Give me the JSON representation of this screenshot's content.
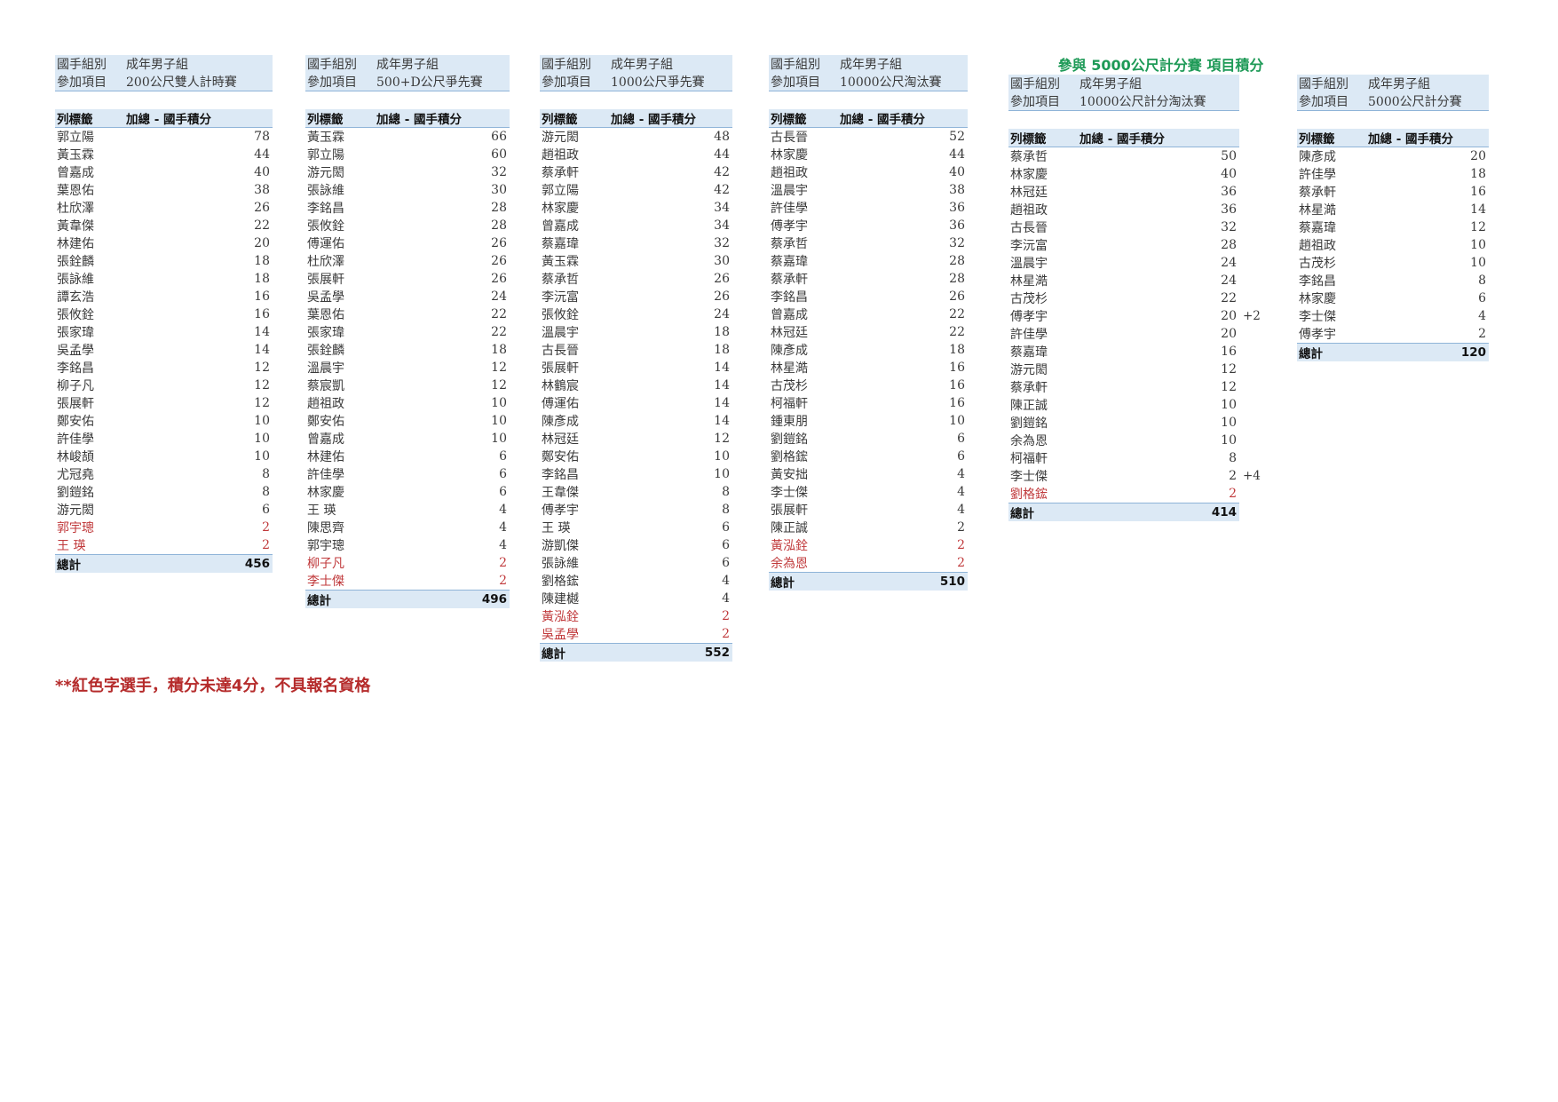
{
  "section_title": "參與 5000公尺計分賽 項目積分",
  "footnote": "**紅色字選手，積分未達4分，不具報名資格",
  "colors": {
    "header_bg": "#dce9f5",
    "header_line": "#8fb4d8",
    "red": "#c0393b",
    "green": "#1e9a57"
  },
  "tables": [
    {
      "group_label": "國手組別",
      "group_value": "成年男子組",
      "event_label": "參加項目",
      "event_value": "200公尺雙人計時賽",
      "col_label": "列標籤",
      "col_value": "加總 - 國手積分",
      "total_label": "總計",
      "total": "456",
      "rows": [
        {
          "name": "郭立陽",
          "pts": "78"
        },
        {
          "name": "黃玉霖",
          "pts": "44"
        },
        {
          "name": "曾嘉成",
          "pts": "40"
        },
        {
          "name": "葉恩佑",
          "pts": "38"
        },
        {
          "name": "杜欣澤",
          "pts": "26"
        },
        {
          "name": "黃韋傑",
          "pts": "22"
        },
        {
          "name": "林建佑",
          "pts": "20"
        },
        {
          "name": "張銓麟",
          "pts": "18"
        },
        {
          "name": "張詠維",
          "pts": "18"
        },
        {
          "name": "譚玄浩",
          "pts": "16"
        },
        {
          "name": "張攸銓",
          "pts": "16"
        },
        {
          "name": "張家瑋",
          "pts": "14"
        },
        {
          "name": "吳孟學",
          "pts": "14"
        },
        {
          "name": "李銘昌",
          "pts": "12"
        },
        {
          "name": "柳子凡",
          "pts": "12"
        },
        {
          "name": "張展軒",
          "pts": "12"
        },
        {
          "name": "鄭安佑",
          "pts": "10"
        },
        {
          "name": "許佳學",
          "pts": "10"
        },
        {
          "name": "林峻頡",
          "pts": "10"
        },
        {
          "name": "尤冠堯",
          "pts": "8"
        },
        {
          "name": "劉鎧銘",
          "pts": "8"
        },
        {
          "name": "游元閎",
          "pts": "6"
        },
        {
          "name": "郭宇璁",
          "pts": "2",
          "red": true
        },
        {
          "name": "王 瑛",
          "pts": "2",
          "red": true
        }
      ]
    },
    {
      "group_label": "國手組別",
      "group_value": "成年男子組",
      "event_label": "參加項目",
      "event_value": "500+D公尺爭先賽",
      "col_label": "列標籤",
      "col_value": "加總 - 國手積分",
      "total_label": "總計",
      "total": "496",
      "rows": [
        {
          "name": "黃玉霖",
          "pts": "66"
        },
        {
          "name": "郭立陽",
          "pts": "60"
        },
        {
          "name": "游元閎",
          "pts": "32"
        },
        {
          "name": "張詠維",
          "pts": "30"
        },
        {
          "name": "李銘昌",
          "pts": "28"
        },
        {
          "name": "張攸銓",
          "pts": "28"
        },
        {
          "name": "傅運佑",
          "pts": "26"
        },
        {
          "name": "杜欣澤",
          "pts": "26"
        },
        {
          "name": "張展軒",
          "pts": "26"
        },
        {
          "name": "吳孟學",
          "pts": "24"
        },
        {
          "name": "葉恩佑",
          "pts": "22"
        },
        {
          "name": "張家瑋",
          "pts": "22"
        },
        {
          "name": "張銓麟",
          "pts": "18"
        },
        {
          "name": "溫晨宇",
          "pts": "12"
        },
        {
          "name": "蔡宸凱",
          "pts": "12"
        },
        {
          "name": "趙祖政",
          "pts": "10"
        },
        {
          "name": "鄭安佑",
          "pts": "10"
        },
        {
          "name": "曾嘉成",
          "pts": "10"
        },
        {
          "name": "林建佑",
          "pts": "6"
        },
        {
          "name": "許佳學",
          "pts": "6"
        },
        {
          "name": "林家慶",
          "pts": "6"
        },
        {
          "name": "王 瑛",
          "pts": "4"
        },
        {
          "name": "陳思齊",
          "pts": "4"
        },
        {
          "name": "郭宇璁",
          "pts": "4"
        },
        {
          "name": "柳子凡",
          "pts": "2",
          "red": true
        },
        {
          "name": "李士傑",
          "pts": "2",
          "red": true
        }
      ]
    },
    {
      "group_label": "國手組別",
      "group_value": "成年男子組",
      "event_label": "參加項目",
      "event_value": "1000公尺爭先賽",
      "col_label": "列標籤",
      "col_value": "加總 - 國手積分",
      "total_label": "總計",
      "total": "552",
      "rows": [
        {
          "name": "游元閎",
          "pts": "48"
        },
        {
          "name": "趙祖政",
          "pts": "44"
        },
        {
          "name": "蔡承軒",
          "pts": "42"
        },
        {
          "name": "郭立陽",
          "pts": "42"
        },
        {
          "name": "林家慶",
          "pts": "34"
        },
        {
          "name": "曾嘉成",
          "pts": "34"
        },
        {
          "name": "蔡嘉瑋",
          "pts": "32"
        },
        {
          "name": "黃玉霖",
          "pts": "30"
        },
        {
          "name": "蔡承哲",
          "pts": "26"
        },
        {
          "name": "李沅富",
          "pts": "26"
        },
        {
          "name": "張攸銓",
          "pts": "24"
        },
        {
          "name": "溫晨宇",
          "pts": "18"
        },
        {
          "name": "古長晉",
          "pts": "18"
        },
        {
          "name": "張展軒",
          "pts": "14"
        },
        {
          "name": "林鶴宸",
          "pts": "14"
        },
        {
          "name": "傅運佑",
          "pts": "14"
        },
        {
          "name": "陳彥成",
          "pts": "14"
        },
        {
          "name": "林冠廷",
          "pts": "12"
        },
        {
          "name": "鄭安佑",
          "pts": "10"
        },
        {
          "name": "李銘昌",
          "pts": "10"
        },
        {
          "name": "王韋傑",
          "pts": "8"
        },
        {
          "name": "傅孝宇",
          "pts": "8"
        },
        {
          "name": "王 瑛",
          "pts": "6"
        },
        {
          "name": "游凱傑",
          "pts": "6"
        },
        {
          "name": "張詠維",
          "pts": "6"
        },
        {
          "name": "劉格鋐",
          "pts": "4"
        },
        {
          "name": "陳建樾",
          "pts": "4"
        },
        {
          "name": "黃泓銓",
          "pts": "2",
          "red": true
        },
        {
          "name": "吳孟學",
          "pts": "2",
          "red": true
        }
      ]
    },
    {
      "group_label": "國手組別",
      "group_value": "成年男子組",
      "event_label": "參加項目",
      "event_value": "10000公尺淘汰賽",
      "col_label": "列標籤",
      "col_value": "加總 - 國手積分",
      "total_label": "總計",
      "total": "510",
      "rows": [
        {
          "name": "古長晉",
          "pts": "52"
        },
        {
          "name": "林家慶",
          "pts": "44"
        },
        {
          "name": "趙祖政",
          "pts": "40"
        },
        {
          "name": "溫晨宇",
          "pts": "38"
        },
        {
          "name": "許佳學",
          "pts": "36"
        },
        {
          "name": "傅孝宇",
          "pts": "36"
        },
        {
          "name": "蔡承哲",
          "pts": "32"
        },
        {
          "name": "蔡嘉瑋",
          "pts": "28"
        },
        {
          "name": "蔡承軒",
          "pts": "28"
        },
        {
          "name": "李銘昌",
          "pts": "26"
        },
        {
          "name": "曾嘉成",
          "pts": "22"
        },
        {
          "name": "林冠廷",
          "pts": "22"
        },
        {
          "name": "陳彥成",
          "pts": "18"
        },
        {
          "name": "林星澔",
          "pts": "16"
        },
        {
          "name": "古茂杉",
          "pts": "16"
        },
        {
          "name": "柯福軒",
          "pts": "16"
        },
        {
          "name": "鍾東朋",
          "pts": "10"
        },
        {
          "name": "劉鎧銘",
          "pts": "6"
        },
        {
          "name": "劉格鋐",
          "pts": "6"
        },
        {
          "name": "黃安拙",
          "pts": "4"
        },
        {
          "name": "李士傑",
          "pts": "4"
        },
        {
          "name": "張展軒",
          "pts": "4"
        },
        {
          "name": "陳正誠",
          "pts": "2"
        },
        {
          "name": "黃泓銓",
          "pts": "2",
          "red": true
        },
        {
          "name": "余為恩",
          "pts": "2",
          "red": true
        }
      ]
    },
    {
      "group_label": "國手組別",
      "group_value": "成年男子組",
      "event_label": "參加項目",
      "event_value": "10000公尺計分淘汰賽",
      "col_label": "列標籤",
      "col_value": "加總 - 國手積分",
      "total_label": "總計",
      "total": "414",
      "rows": [
        {
          "name": "蔡承哲",
          "pts": "50"
        },
        {
          "name": "林家慶",
          "pts": "40"
        },
        {
          "name": "林冠廷",
          "pts": "36"
        },
        {
          "name": "趙祖政",
          "pts": "36"
        },
        {
          "name": "古長晉",
          "pts": "32"
        },
        {
          "name": "李沅富",
          "pts": "28"
        },
        {
          "name": "溫晨宇",
          "pts": "24"
        },
        {
          "name": "林星澔",
          "pts": "24"
        },
        {
          "name": "古茂杉",
          "pts": "22"
        },
        {
          "name": "傅孝宇",
          "pts": "20",
          "note": "+2"
        },
        {
          "name": "許佳學",
          "pts": "20"
        },
        {
          "name": "蔡嘉瑋",
          "pts": "16"
        },
        {
          "name": "游元閎",
          "pts": "12"
        },
        {
          "name": "蔡承軒",
          "pts": "12"
        },
        {
          "name": "陳正誠",
          "pts": "10"
        },
        {
          "name": "劉鎧銘",
          "pts": "10"
        },
        {
          "name": "余為恩",
          "pts": "10"
        },
        {
          "name": "柯福軒",
          "pts": "8"
        },
        {
          "name": "李士傑",
          "pts": "2",
          "note": "+4"
        },
        {
          "name": "劉格鋐",
          "pts": "2",
          "red": true
        }
      ]
    },
    {
      "group_label": "國手組別",
      "group_value": "成年男子組",
      "event_label": "參加項目",
      "event_value": "5000公尺計分賽",
      "col_label": "列標籤",
      "col_value": "加總 - 國手積分",
      "total_label": "總計",
      "total": "120",
      "rows": [
        {
          "name": "陳彥成",
          "pts": "20"
        },
        {
          "name": "許佳學",
          "pts": "18"
        },
        {
          "name": "蔡承軒",
          "pts": "16"
        },
        {
          "name": "林星澔",
          "pts": "14"
        },
        {
          "name": "蔡嘉瑋",
          "pts": "12"
        },
        {
          "name": "趙祖政",
          "pts": "10"
        },
        {
          "name": "古茂杉",
          "pts": "10"
        },
        {
          "name": "李銘昌",
          "pts": "8"
        },
        {
          "name": "林家慶",
          "pts": "6"
        },
        {
          "name": "李士傑",
          "pts": "4"
        },
        {
          "name": "傅孝宇",
          "pts": "2"
        }
      ]
    }
  ]
}
